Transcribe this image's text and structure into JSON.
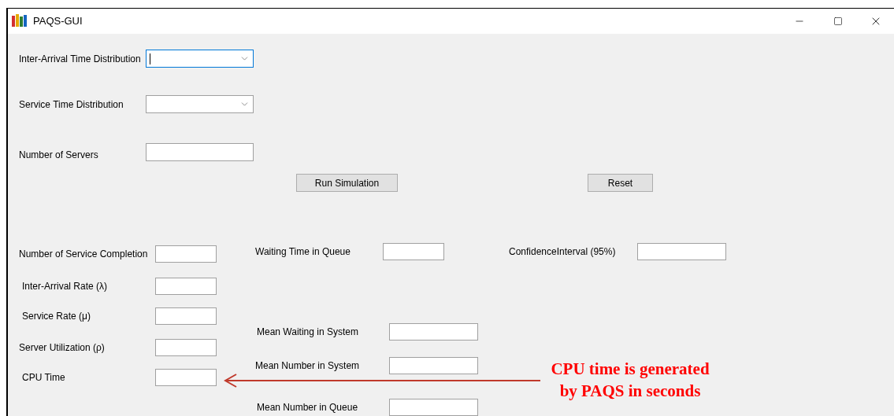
{
  "window": {
    "title": "PAQS-GUI"
  },
  "inputs": [
    {
      "label": "Inter-Arrival Time Distribution",
      "kind": "dropdown",
      "focused": true
    },
    {
      "label": "Service Time Distribution",
      "kind": "dropdown",
      "focused": false
    },
    {
      "label": "Number of Servers",
      "kind": "text",
      "focused": false
    }
  ],
  "buttons": [
    "Run Simulation",
    "Reset"
  ],
  "results_left": [
    "Number of Service Completion",
    "Inter-Arrival Rate (λ)",
    "Service Rate (μ)",
    "Server Utilization (ρ)",
    "CPU Time"
  ],
  "results_middle": [
    "Waiting Time in Queue",
    "Mean Waiting in System",
    "Mean Number in System",
    "Mean Number in Queue"
  ],
  "results_right": [
    "ConfidenceInterval (95%)"
  ],
  "annotation": {
    "lines": [
      "CPU time is generated",
      "by PAQS in seconds"
    ]
  }
}
